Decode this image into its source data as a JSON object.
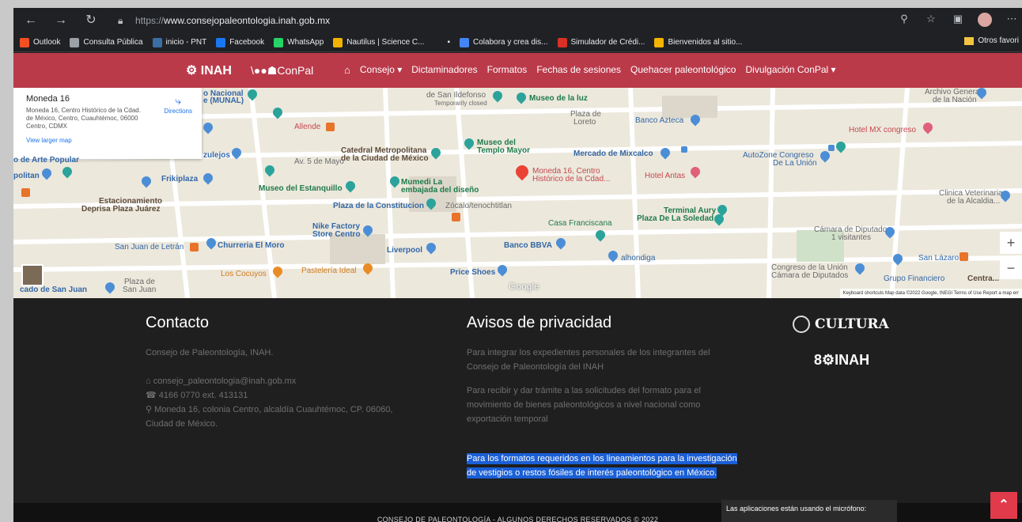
{
  "browser": {
    "url_proto": "https://",
    "url_rest": "www.consejopaleontologia.inah.gob.mx",
    "bookmarks": [
      {
        "label": "Outlook",
        "color": "#f25022"
      },
      {
        "label": "Consulta Pública",
        "color": "#9aa0a6"
      },
      {
        "label": "inicio - PNT",
        "color": "#3a6ea5"
      },
      {
        "label": "Facebook",
        "color": "#1877f2"
      },
      {
        "label": "WhatsApp",
        "color": "#25d366"
      },
      {
        "label": "Nautilus | Science C...",
        "color": "#f0b400"
      },
      {
        "label": "▪",
        "color": "#202124"
      },
      {
        "label": "Colabora y crea dis...",
        "color": "#4285f4"
      },
      {
        "label": "Simulador de Crédi...",
        "color": "#d93025"
      },
      {
        "label": "Bienvenidos al sitio...",
        "color": "#f4b400"
      }
    ],
    "other_bookmarks": "Otros favori"
  },
  "site": {
    "logo_inah": "INAH",
    "logo_conpal": "ConPal",
    "menu": [
      "Consejo ▾",
      "Dictaminadores",
      "Formatos",
      "Fechas de sesiones",
      "Quehacer paleontológico",
      "Divulgación ConPal ▾"
    ]
  },
  "map": {
    "card": {
      "title": "Moneda 16",
      "address": "Moneda 16, Centro Histórico de la Cdad. de México, Centro, Cuauhtémoc, 06000 Centro, CDMX",
      "larger": "View larger map",
      "directions": "Directions"
    },
    "labels": {
      "munal": "e (MUNAL)",
      "munal_top": "o Nacional",
      "allende": "Allende",
      "azulejos": "zulejos",
      "arte_popular": "o de Arte Popular",
      "politan": "politan",
      "frikiplaza": "Frikiplaza",
      "estacionamiento": "Estacionamiento",
      "deprisa": "Deprisa Plaza Juárez",
      "catedral": "Catedral Metropolitana",
      "catedral2": "de la Ciudad de México",
      "museo_estanquillo": "Museo del Estanquillo",
      "mumedi": "Mumedi La",
      "mumedi2": "embajada del diseño",
      "templo": "Museo del",
      "templo2": "Templo Mayor",
      "san_ildefonso": "de San Ildefonso",
      "temp_closed": "Temporarily closed",
      "museo_luz": "Museo de la luz",
      "plaza_loreto": "Plaza de",
      "plaza_loreto2": "Loreto",
      "banco_azteca": "Banco Azteca",
      "mercado_mixcalco": "Mercado de Mixcalco",
      "autozone": "AutoZone Congreso",
      "autozone2": "De La Unión",
      "archivo": "Archivo General",
      "archivo2": "de la Nación",
      "hotel_congreso": "Hotel MX congreso",
      "moneda_pin": "Moneda 16, Centro",
      "moneda_pin2": "Histórico de la Cdad...",
      "hotel_antas": "Hotel Antas",
      "plaza_constitucion": "Plaza de la Constitucion",
      "zocalo": "Zócalo/tenochtitlan",
      "terminal_aury": "Terminal Aury",
      "plaza_soledad": "Plaza De La Soledad",
      "clinica": "Clinica Veterinaria",
      "clinica2": "de la Alcaldia...",
      "nike": "Nike Factory",
      "nike2": "Store Centro",
      "casa_francisca": "Casa Franciscana",
      "camara_diputados": "Cámara de Diputados",
      "visitantes": "1 visitantes",
      "san_juan_letran": "San Juan de Letrán",
      "churreria": "Churreria El Moro",
      "liverpool": "Liverpool",
      "banco_bbva": "Banco BBVA",
      "alhondiga": "alhondiga",
      "san_lazaro": "San Lázaro",
      "congreso": "Congreso de la Unión",
      "congreso2": "Cámara de Diputados",
      "grupo_fin": "Grupo Financiero",
      "centra": "Centra...",
      "cocuyos": "Los Cocuyos",
      "pasteleria": "Pastelería Ideal",
      "price_shoes": "Price Shoes",
      "mercado_san_juan": "cado de San Juan",
      "plaza_san_juan": "Plaza de",
      "plaza_san_juan2": "San Juan",
      "av_5_mayo": "Av. 5 de Mayo",
      "google": "Google",
      "footer": "Keyboard shortcuts   Map data ©2022 Google, INEGI   Terms of Use   Report a map err"
    }
  },
  "footer": {
    "contact_heading": "Contacto",
    "contact_org": "Consejo de Paleontología, INAH.",
    "contact_email": "consejo_paleontologia@inah.gob.mx",
    "contact_phone": "4166 0770 ext. 413131",
    "contact_address": "Moneda 16, colonia Centro, alcaldía Cuauhtémoc, CP. 06060,",
    "contact_city": "Ciudad de México.",
    "privacy_heading": "Avisos de privacidad",
    "privacy_p1_l1": "Para integrar los expedientes personales de los integrantes del",
    "privacy_p1_l2": "Consejo de Paleontología del INAH",
    "privacy_p2_l1": "Para recibir y dar trámite a las solicitudes del formato para el",
    "privacy_p2_l2": "movimiento de bienes paleontológicos a nivel nacional como",
    "privacy_p2_l3": "exportación temporal",
    "privacy_p3_l1": "Para los formatos requeridos en los lineamientos para la investigación",
    "privacy_p3_l2": "de vestigios o restos fósiles de interés paleontológico en México.",
    "cultura": "CULTURA",
    "inah80": "INAH",
    "copyright": "CONSEJO DE PALEONTOLOGÍA - ALGUNOS DERECHOS RESERVADOS © 2022",
    "toast": "Las aplicaciones están usando el micrófono:"
  }
}
